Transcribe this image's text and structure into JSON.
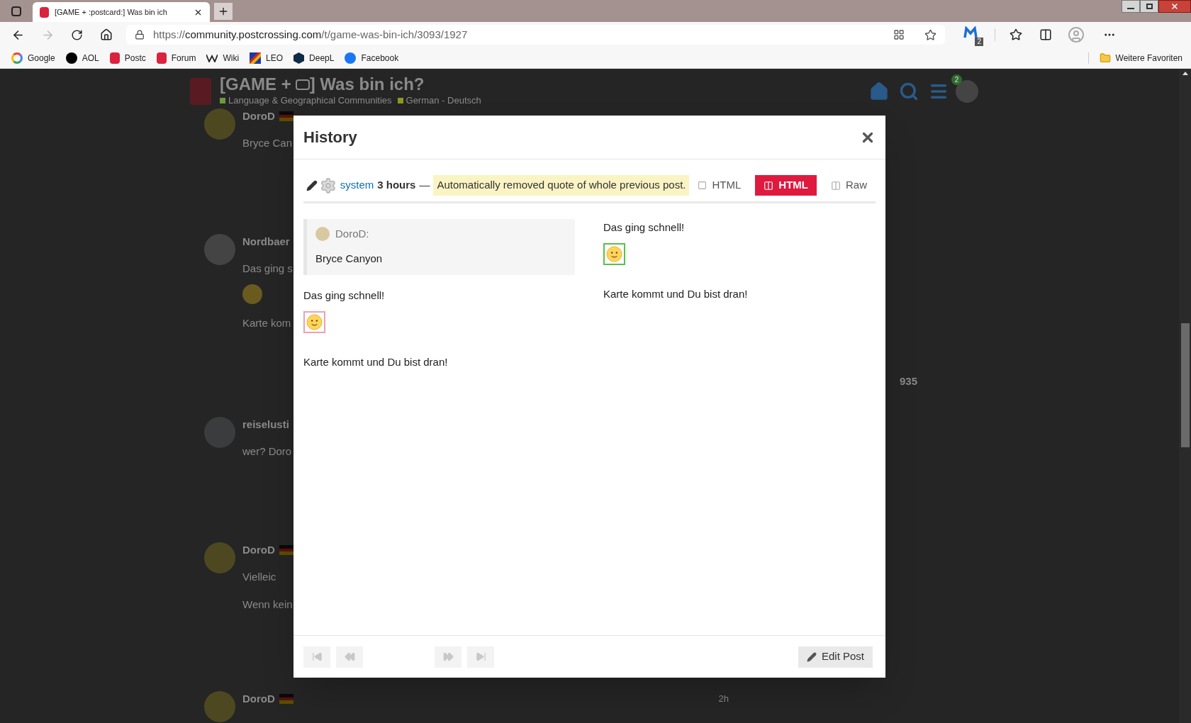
{
  "browser": {
    "tab_title": "[GAME + :postcard:] Was bin ich",
    "url": {
      "scheme": "https://",
      "host": "community.postcrossing.com",
      "path": "/t/game-was-bin-ich/3093/1927"
    },
    "extension_badge": "2",
    "bookmarks": [
      "Google",
      "AOL",
      "Postc",
      "Forum",
      "Wiki",
      "LEO",
      "DeepL",
      "Facebook"
    ],
    "other_favorites": "Weitere Favoriten"
  },
  "page": {
    "title_start": "[GAME +",
    "title_end": "] Was bin ich?",
    "notification_count": "2",
    "breadcrumbs": [
      {
        "label": "Language & Geographical Communities",
        "color": "#6b9b3b"
      },
      {
        "label": "German - Deutsch",
        "color": "#8a9a20"
      }
    ],
    "posts": [
      {
        "author": "DoroD",
        "flag": true,
        "lines": [
          "Bryce Can"
        ]
      },
      {
        "author": "Nordbaer",
        "lines": [
          "Das ging s",
          "Karte kom"
        ],
        "emoji": true,
        "side": "935"
      },
      {
        "author": "reiselusti",
        "lines": [
          "wer? Doro"
        ]
      },
      {
        "author": "DoroD",
        "flag": true,
        "lines": [
          "Vielleic",
          "Wenn kein"
        ]
      },
      {
        "author": "DoroD",
        "flag": true,
        "side": "2h"
      }
    ]
  },
  "modal": {
    "title": "History",
    "revision": {
      "user": "system",
      "age": "3 hours",
      "dash": "—",
      "reason": "Automatically removed quote of whole previous post."
    },
    "view_modes": [
      {
        "label": "HTML",
        "selected": false
      },
      {
        "label": "HTML",
        "selected": true
      },
      {
        "label": "Raw",
        "selected": false
      }
    ],
    "before": {
      "quote": {
        "author": "DoroD:",
        "text": "Bryce Canyon"
      },
      "blocks": [
        {
          "kind": "text",
          "text": "Das ging schnell!"
        },
        {
          "kind": "emoji",
          "color": "#f0a0b0"
        },
        {
          "kind": "text",
          "text": "Karte kommt und Du bist dran!"
        }
      ]
    },
    "after": {
      "blocks": [
        {
          "kind": "text",
          "text": "Das ging schnell!"
        },
        {
          "kind": "emoji",
          "color": "#55c24a"
        },
        {
          "kind": "text",
          "text": "Karte kommt und Du bist dran!"
        }
      ]
    },
    "nav": [
      {
        "kind": "first",
        "disabled": true
      },
      {
        "kind": "previous",
        "disabled": true
      },
      {
        "kind": "next",
        "disabled": true
      },
      {
        "kind": "last",
        "disabled": true
      }
    ],
    "edit_button": "Edit Post"
  }
}
